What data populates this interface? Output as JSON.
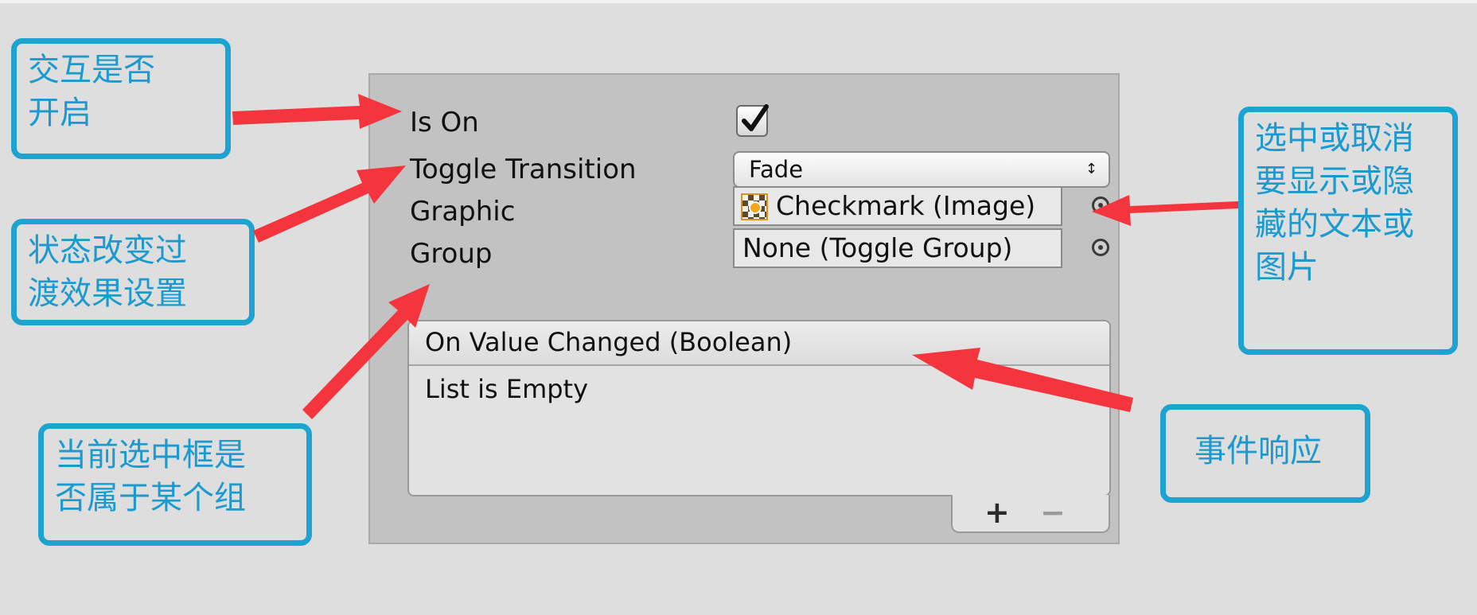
{
  "inspector": {
    "is_on_label": "Is On",
    "is_on_checked": true,
    "toggle_transition_label": "Toggle Transition",
    "toggle_transition_value": "Fade",
    "graphic_label": "Graphic",
    "graphic_value": "Checkmark (Image)",
    "group_label": "Group",
    "group_value": "None (Toggle Group)",
    "event_header": "On Value Changed (Boolean)",
    "event_body": "List is Empty",
    "add_label": "+",
    "remove_label": "−"
  },
  "callouts": {
    "is_on": [
      "交互是否",
      "开启"
    ],
    "transition": [
      "状态改变过",
      "渡效果设置"
    ],
    "group": [
      "当前选中框是",
      "否属于某个组"
    ],
    "graphic": [
      "选中或取消",
      "要显示或隐",
      "藏的文本或",
      "图片"
    ],
    "event": [
      "事件响应"
    ]
  },
  "colors": {
    "callout_border": "#1ea3d1",
    "callout_text": "#1b9ad0",
    "arrow": "#f5353e",
    "panel_bg": "#c2c2c2",
    "page_bg": "#dedede"
  }
}
